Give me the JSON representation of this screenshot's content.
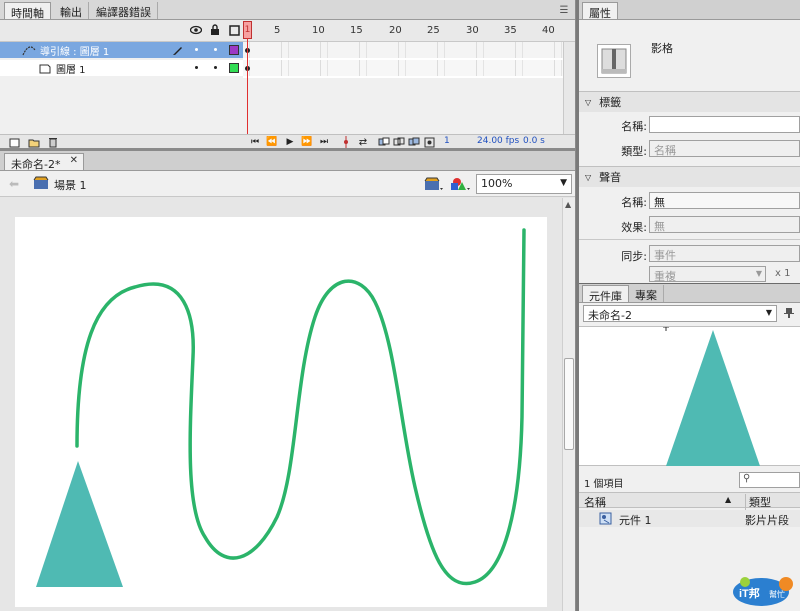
{
  "timeline": {
    "tabs": [
      "時間軸",
      "輸出",
      "編譯器錯誤"
    ],
    "frame_numbers": [
      "1",
      "5",
      "10",
      "15",
      "20",
      "25",
      "30",
      "35",
      "40"
    ],
    "layers": [
      {
        "name": "導引線 : 圖層 1"
      },
      {
        "name": "圖層 1"
      }
    ],
    "fps": "24.00 fps",
    "time": "0.0 s",
    "current_frame": "1"
  },
  "document": {
    "tab": "未命名-2*",
    "scene": "場景 1",
    "zoom": "100%"
  },
  "properties": {
    "tab": "屬性",
    "type": "影格",
    "label_section": "標籤",
    "name_label": "名稱:",
    "type_label": "類型:",
    "type_value": "名稱",
    "sound_section": "聲音",
    "sound_name_label": "名稱:",
    "sound_name_value": "無",
    "effect_label": "效果:",
    "effect_value": "無",
    "sync_label": "同步:",
    "sync_value": "事件",
    "repeat_value": "重複",
    "repeat_count": "x 1"
  },
  "library": {
    "tabs": [
      "元件庫",
      "專案"
    ],
    "document": "未命名-2",
    "item_count": "1 個項目",
    "col_name": "名稱",
    "col_type": "類型",
    "items": [
      {
        "name": "元件 1",
        "type": "影片片段"
      }
    ],
    "watermark": "IT邦幫忙"
  },
  "colors": {
    "stage": "#ffffff",
    "path": "#2bb46a",
    "triangle": "#4fbab3",
    "selected": "#7aa7e0"
  }
}
